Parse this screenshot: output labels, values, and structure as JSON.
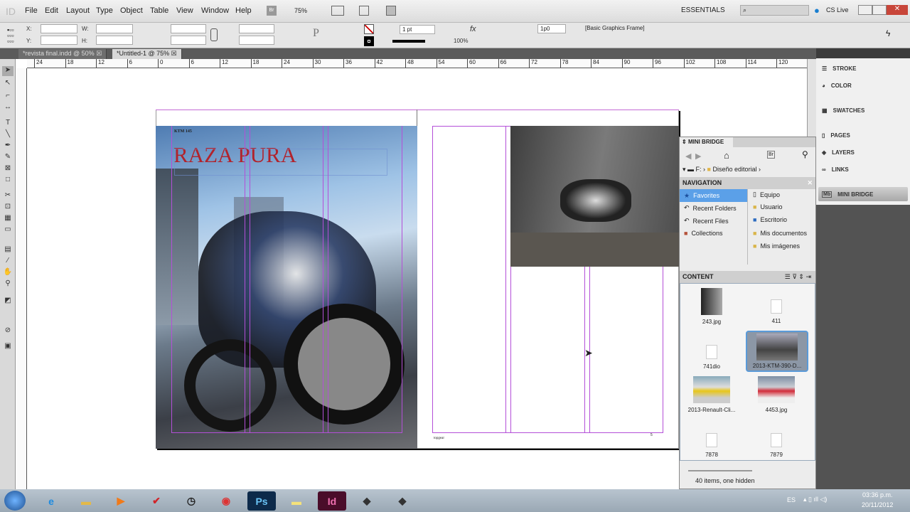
{
  "menubar": {
    "logo": "ID",
    "items": [
      "File",
      "Edit",
      "Layout",
      "Type",
      "Object",
      "Table",
      "View",
      "Window",
      "Help"
    ],
    "bridge": "Br",
    "zoom": "75%",
    "workspace": "ESSENTIALS",
    "cs_live": "CS Live",
    "search_placeholder": ""
  },
  "control": {
    "x_label": "X:",
    "y_label": "Y:",
    "w_label": "W:",
    "h_label": "H:",
    "stroke_weight": "1 pt",
    "opacity": "100%",
    "gap": "1p0",
    "object_style": "[Basic Graphics Frame]"
  },
  "tabs": [
    {
      "label": "*revista final.indd @ 50%"
    },
    {
      "label": "*Untitled-1 @ 75%"
    }
  ],
  "ruler": [
    "24",
    "18",
    "12",
    "6",
    "0",
    "6",
    "12",
    "18",
    "24",
    "30",
    "36",
    "42",
    "48",
    "54",
    "60",
    "66",
    "72",
    "78",
    "84",
    "90",
    "96",
    "102",
    "108",
    "114",
    "120",
    "12"
  ],
  "page": {
    "kicker": "KTM 145",
    "headline": "RAZA PURA",
    "footer": "topgear",
    "page_number": "5"
  },
  "panels": [
    {
      "label": "STROKE",
      "icon": "stroke-icon"
    },
    {
      "label": "COLOR",
      "icon": "color-icon"
    },
    {
      "label": "SWATCHES",
      "icon": "swatches-icon"
    },
    {
      "label": "PAGES",
      "icon": "pages-icon"
    },
    {
      "label": "LAYERS",
      "icon": "layers-icon"
    },
    {
      "label": "LINKS",
      "icon": "links-icon"
    },
    {
      "label": "MINI BRIDGE",
      "icon": "mini-bridge-icon"
    }
  ],
  "minibridge": {
    "title": "MINI BRIDGE",
    "path_drive": "F:",
    "path_folder": "Diseño editorial",
    "navigation": "NAVIGATION",
    "nav_left": [
      "Favorites",
      "Recent Folders",
      "Recent Files",
      "Collections"
    ],
    "nav_right": [
      "Equipo",
      "Usuario",
      "Escritorio",
      "Mis documentos",
      "Mis imágenes"
    ],
    "content": "CONTENT",
    "items": [
      "243.jpg",
      "411",
      "741dio",
      "2013-KTM-390-D...",
      "2013-Renault-Cli...",
      "4453.jpg",
      "7878",
      "7879"
    ],
    "status": "40 items, one hidden"
  },
  "taskbar": {
    "lang": "ES",
    "time": "03:36 p.m.",
    "date": "20/11/2012"
  }
}
